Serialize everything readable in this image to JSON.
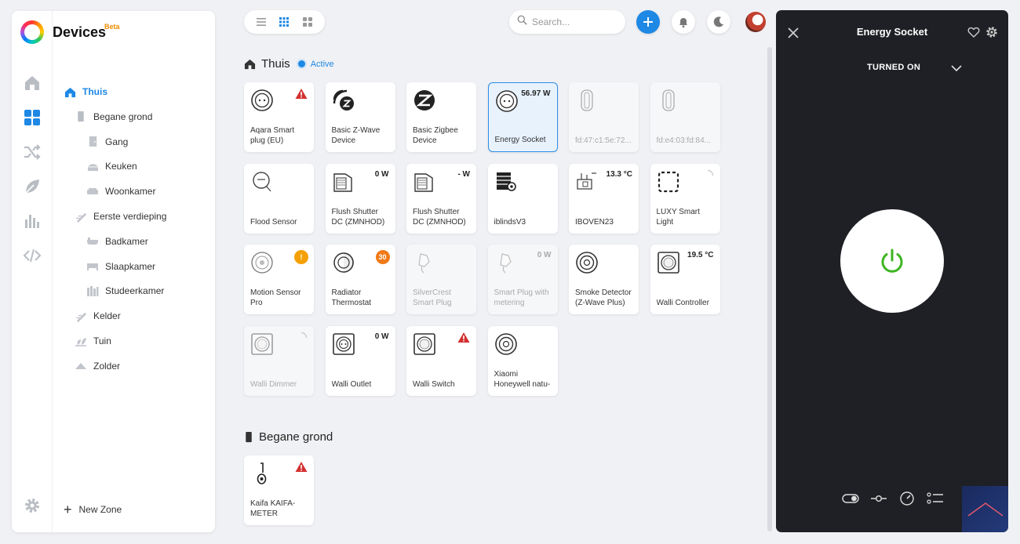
{
  "app": {
    "title": "Devices",
    "badge": "Beta"
  },
  "sidebar": {
    "zones": [
      {
        "label": "Thuis",
        "icon": "home-icon",
        "level": 0,
        "active": true
      },
      {
        "label": "Begane grond",
        "icon": "floor-icon",
        "level": 1
      },
      {
        "label": "Gang",
        "icon": "door-icon",
        "level": 2
      },
      {
        "label": "Keuken",
        "icon": "kitchen-icon",
        "level": 2
      },
      {
        "label": "Woonkamer",
        "icon": "sofa-icon",
        "level": 2
      },
      {
        "label": "Eerste verdieping",
        "icon": "stairs-icon",
        "level": 1
      },
      {
        "label": "Badkamer",
        "icon": "bath-icon",
        "level": 2
      },
      {
        "label": "Slaapkamer",
        "icon": "bed-icon",
        "level": 2
      },
      {
        "label": "Studeerkamer",
        "icon": "books-icon",
        "level": 2
      },
      {
        "label": "Kelder",
        "icon": "stairs-icon",
        "level": 1
      },
      {
        "label": "Tuin",
        "icon": "garden-icon",
        "level": 1
      },
      {
        "label": "Zolder",
        "icon": "attic-icon",
        "level": 1
      }
    ],
    "new_zone": "New Zone"
  },
  "search": {
    "placeholder": "Search..."
  },
  "sections": [
    {
      "title": "Thuis",
      "status": "Active"
    },
    {
      "title": "Begane grond"
    }
  ],
  "devices": [
    {
      "name": "Aqara Smart plug (EU)",
      "value": "",
      "icon": "socket-icon",
      "alert": "warning"
    },
    {
      "name": "Basic Z-Wave Device",
      "value": "",
      "icon": "zwave-icon"
    },
    {
      "name": "Basic Zigbee Device",
      "value": "",
      "icon": "zigbee-icon"
    },
    {
      "name": "Energy Socket",
      "value": "56.97 W",
      "icon": "socket-icon",
      "selected": true
    },
    {
      "name": "fd:47:c1:5e:72...",
      "value": "",
      "icon": "sensor-icon",
      "disabled": true
    },
    {
      "name": "fd:e4:03:fd:84...",
      "value": "",
      "icon": "sensor-icon",
      "disabled": true
    },
    {
      "name": "Flood Sensor",
      "value": "",
      "icon": "flood-icon"
    },
    {
      "name": "Flush Shutter DC (ZMNHOD)",
      "value": "0 W",
      "icon": "shutter-icon"
    },
    {
      "name": "Flush Shutter DC (ZMNHOD)",
      "value": "- W",
      "icon": "shutter-icon"
    },
    {
      "name": "iblindsV3",
      "value": "",
      "icon": "blinds-icon"
    },
    {
      "name": "IBOVEN23",
      "value": "13.3 °C",
      "icon": "thermo-icon"
    },
    {
      "name": "LUXY Smart Light",
      "value": "",
      "icon": "light-icon",
      "loading": true
    },
    {
      "name": "Motion Sensor Pro",
      "value": "",
      "icon": "motion-icon",
      "badge": "!",
      "badge_color": "#f5a000"
    },
    {
      "name": "Radiator Thermostat",
      "value": "",
      "icon": "thermostat-icon",
      "badge": "30",
      "badge_color": "#f07a17"
    },
    {
      "name": "SilverCrest Smart Plug",
      "value": "",
      "icon": "plug-icon",
      "disabled": true
    },
    {
      "name": "Smart Plug with metering",
      "value": "0 W",
      "icon": "plug-icon",
      "disabled": true
    },
    {
      "name": "Smoke Detector (Z-Wave Plus)",
      "value": "",
      "icon": "smoke-icon"
    },
    {
      "name": "Walli Controller",
      "value": "19.5 °C",
      "icon": "wallswitch-icon"
    },
    {
      "name": "Walli Dimmer",
      "value": "",
      "icon": "wallswitch-icon",
      "disabled": true,
      "loading": true
    },
    {
      "name": "Walli Outlet",
      "value": "0 W",
      "icon": "walloutlet-icon"
    },
    {
      "name": "Walli Switch",
      "value": "",
      "icon": "wallswitch-icon",
      "alert": "danger"
    },
    {
      "name": "Xiaomi Honeywell natu-",
      "value": "",
      "icon": "smoke-icon"
    }
  ],
  "ground_floor_devices": [
    {
      "name": "Kaifa KAIFA-METER",
      "value": "",
      "icon": "meter-icon",
      "alert": "danger"
    }
  ],
  "panel": {
    "title": "Energy Socket",
    "state": "TURNED ON",
    "power_color": "#3cb521"
  },
  "colors": {
    "accent": "#1e88e5",
    "warning": "#d32f2f",
    "panel_bg": "#1e2025"
  }
}
